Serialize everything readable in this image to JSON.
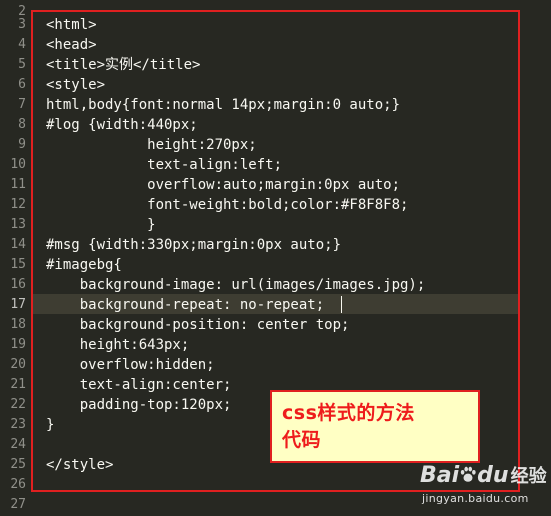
{
  "editor": {
    "line_numbers": [
      "2",
      "3",
      "4",
      "5",
      "6",
      "7",
      "8",
      "9",
      "10",
      "11",
      "12",
      "13",
      "14",
      "15",
      "16",
      "17",
      "18",
      "19",
      "20",
      "21",
      "22",
      "23",
      "24",
      "25",
      "26",
      "27"
    ],
    "active_line": "17",
    "lines": [
      "",
      "<html>",
      "<head>",
      "<title>实例</title>",
      "<style>",
      "html,body{font:normal 14px;margin:0 auto;}",
      "#log {width:440px;",
      "            height:270px;",
      "            text-align:left;",
      "            overflow:auto;margin:0px auto;",
      "            font-weight:bold;color:#F8F8F8;",
      "            }",
      "#msg {width:330px;margin:0px auto;}",
      "#imagebg{",
      "    background-image: url(images/images.jpg);",
      "    background-repeat: no-repeat;",
      "    background-position: center top;",
      "    height:643px;",
      "    overflow:hidden;",
      "    text-align:center;",
      "    padding-top:120px;",
      "}",
      "",
      "</style>",
      "",
      ""
    ]
  },
  "callout": {
    "line1": "css样式的方法",
    "line2": "代码"
  },
  "watermark": {
    "logo": "Bai",
    "logo_suffix": "du",
    "sub": "经验",
    "url": "jingyan.baidu.com"
  },
  "colors": {
    "background": "#272822",
    "text": "#f8f8f2",
    "gutter_text": "#90908a",
    "highlight_border": "#e02020",
    "callout_bg": "#ffffc4",
    "callout_text": "#ee1c1c"
  }
}
